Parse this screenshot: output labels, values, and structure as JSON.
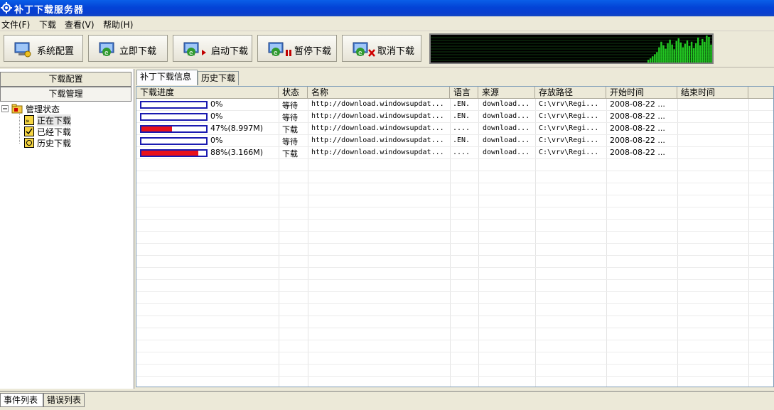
{
  "window": {
    "title": "补丁下载服务器"
  },
  "menu": [
    "文件(F)",
    "下载",
    "查看(V)",
    "帮助(H)"
  ],
  "toolbar": {
    "buttons": [
      "系统配置",
      "立即下载",
      "启动下载",
      "暂停下载",
      "取消下载"
    ]
  },
  "left_panel": {
    "buttons": [
      "下载配置",
      "下载管理"
    ],
    "tree": {
      "root": "管理状态",
      "children": [
        "正在下载",
        "已经下载",
        "历史下载"
      ]
    }
  },
  "tabs": [
    "补丁下载信息",
    "历史下载"
  ],
  "table": {
    "columns": [
      "下载进度",
      "状态",
      "名称",
      "语言",
      "来源",
      "存放路径",
      "开始时间",
      "结束时间"
    ],
    "rows": [
      {
        "progress": 0,
        "progress_text": "0%",
        "status": "等待",
        "name": "http://download.windowsupdat...",
        "lang": ".EN.",
        "source": "download...",
        "path": "C:\\vrv\\Regi...",
        "start": "2008-08-22 ...",
        "end": ""
      },
      {
        "progress": 0,
        "progress_text": "0%",
        "status": "等待",
        "name": "http://download.windowsupdat...",
        "lang": ".EN.",
        "source": "download...",
        "path": "C:\\vrv\\Regi...",
        "start": "2008-08-22 ...",
        "end": ""
      },
      {
        "progress": 47,
        "progress_text": "47%(8.997M)",
        "status": "下载",
        "name": "http://download.windowsupdat...",
        "lang": "....",
        "source": "download...",
        "path": "C:\\vrv\\Regi...",
        "start": "2008-08-22 ...",
        "end": ""
      },
      {
        "progress": 0,
        "progress_text": "0%",
        "status": "等待",
        "name": "http://download.windowsupdat...",
        "lang": ".EN.",
        "source": "download...",
        "path": "C:\\vrv\\Regi...",
        "start": "2008-08-22 ...",
        "end": ""
      },
      {
        "progress": 88,
        "progress_text": "88%(3.166M)",
        "status": "下载",
        "name": "http://download.windowsupdat...",
        "lang": "....",
        "source": "download...",
        "path": "C:\\vrv\\Regi...",
        "start": "2008-08-22 ...",
        "end": ""
      }
    ]
  },
  "bottom_tabs": [
    "事件列表",
    "错误列表"
  ],
  "graph": {
    "levels": [
      0,
      0,
      0,
      0,
      0,
      0,
      0,
      0,
      0,
      0,
      0,
      0,
      0,
      0,
      0,
      0,
      0,
      0,
      0,
      0,
      0,
      0,
      0,
      0,
      0,
      0,
      0,
      0,
      0,
      0,
      0,
      0,
      0,
      0,
      0,
      0,
      0,
      0,
      0,
      0,
      0,
      0,
      0,
      0,
      0,
      0,
      0,
      0,
      0,
      0,
      0,
      0,
      0,
      0,
      0,
      0,
      0,
      0,
      0,
      0,
      0,
      0,
      0,
      0,
      0,
      0,
      0,
      0,
      0,
      0,
      0,
      0,
      0,
      0,
      0,
      0,
      0,
      0,
      0,
      0,
      0,
      0,
      0,
      0,
      0,
      0,
      0,
      0,
      0,
      0,
      0,
      0,
      0,
      0,
      0,
      0,
      0,
      0,
      0,
      0,
      4,
      6,
      9,
      12,
      15,
      22,
      30,
      25,
      20,
      28,
      33,
      26,
      19,
      31,
      35,
      29,
      22,
      27,
      32,
      24,
      30,
      21,
      28,
      36,
      25,
      34,
      30,
      39,
      37,
      26
    ],
    "color": "#22c722",
    "grid_color": "#1f7a1f"
  },
  "colors": {
    "progress_fill": "#e8101a",
    "progress_border": "#1a1ab0"
  }
}
